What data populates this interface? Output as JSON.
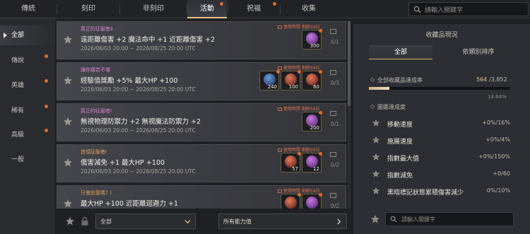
{
  "tabs": [
    {
      "label": "傳統",
      "dot": false
    },
    {
      "label": "刻印",
      "dot": false
    },
    {
      "label": "非刻印",
      "dot": false
    },
    {
      "label": "活動",
      "dot": true
    },
    {
      "label": "祝福",
      "dot": true
    },
    {
      "label": "收集",
      "dot": false
    }
  ],
  "active_tab": "活動",
  "search": {
    "placeholder": "請輸入關鍵字"
  },
  "sidebar": {
    "items": [
      {
        "label": "全部",
        "active": true,
        "dot": false
      },
      {
        "label": "傳說",
        "active": false,
        "dot": true
      },
      {
        "label": "英雄",
        "active": false,
        "dot": true
      },
      {
        "label": "稀有",
        "active": false,
        "dot": true
      },
      {
        "label": "高級",
        "active": false,
        "dot": true
      },
      {
        "label": "一般",
        "active": false,
        "dot": false
      }
    ]
  },
  "collections": [
    {
      "category": "真正的征服者Ⅱ",
      "category_color": "#d985d4",
      "expiry": "使用時間 剩餘59日",
      "description": "遠距離傷害 +2 魔法命中 +1 近距離傷害 +2",
      "date": "2026/06/03 20:00 ~ 2026/08/25 20:00 UTC",
      "progress": "0/1",
      "items": [
        {
          "count": "300",
          "color": "purple",
          "dot": true
        }
      ]
    },
    {
      "category": "讓你痛苦不堪",
      "category_color": "#d985d4",
      "expiry": "使用時間 剩餘59日",
      "description": "經驗值獎勵 +5% 最大HP +100",
      "date": "2026/06/03 20:00 ~ 2026/08/25 20:00 UTC",
      "progress": "0/3",
      "items": [
        {
          "count": "240",
          "color": "blue",
          "dot": true
        },
        {
          "count": "100",
          "color": "red",
          "dot": true
        },
        {
          "count": "60",
          "color": "purple",
          "dot": true
        }
      ]
    },
    {
      "category": "真正的征服者Ⅰ",
      "category_color": "#d985d4",
      "expiry": "使用時間 剩餘59日",
      "description": "無視物理防禦力 +2 無視魔法防禦力 +2",
      "date": "2026/06/03 20:00 ~ 2026/08/25 20:00 UTC",
      "progress": "0/1",
      "items": [
        {
          "count": "200",
          "color": "purple",
          "dot": true
        }
      ]
    },
    {
      "category": "首領征服者Ⅰ",
      "category_color": "#e0a05a",
      "expiry": "使用時間 剩餘59日",
      "description": "傷害減免 +1 最大HP +100",
      "date": "2026/06/03 20:00 ~ 2026/08/25 20:00 UTC",
      "progress": "0/2",
      "items": [
        {
          "count": "57",
          "color": "red",
          "dot": true
        },
        {
          "count": "12",
          "color": "purple",
          "dot": true
        }
      ]
    },
    {
      "category": "只會防禦嗎？Ⅰ",
      "category_color": "#e0a05a",
      "expiry": "使用時間 剩餘59日",
      "description": "最大HP +100 近距離迴避力 +1",
      "date": "",
      "progress": "0/2",
      "items": [
        {
          "count": "",
          "color": "red",
          "dot": true
        },
        {
          "count": "",
          "color": "purple",
          "dot": true
        }
      ]
    }
  ],
  "bottom": {
    "filter_value": "全部",
    "ability_label": "所有能力值"
  },
  "right_panel": {
    "title": "收藏品現況",
    "tabs": [
      "全部",
      "依類別排序"
    ],
    "total_label": "全部收藏品達成率",
    "total_current": "564",
    "total_max": "/3,852",
    "total_percent_text": "14.64%",
    "total_fraction": 0.1464,
    "section_label": "圖鑑達成度",
    "stats": [
      {
        "label": "移動速度",
        "value": "+0%/16%"
      },
      {
        "label": "施展速度",
        "value": "+0%/4%"
      },
      {
        "label": "指數最大值",
        "value": "+0%/150%"
      },
      {
        "label": "指數減免",
        "value": "+0/60"
      },
      {
        "label": "黑暗標記狀態累積傷害減少",
        "value": "0%/10%"
      }
    ],
    "search_placeholder": "請輸入關鍵字"
  },
  "colors": {
    "accent_gold": "#e0c48a",
    "notification_dot": "#e06a2c",
    "legend_purple": "#d985d4",
    "epic_orange": "#e0a05a"
  }
}
